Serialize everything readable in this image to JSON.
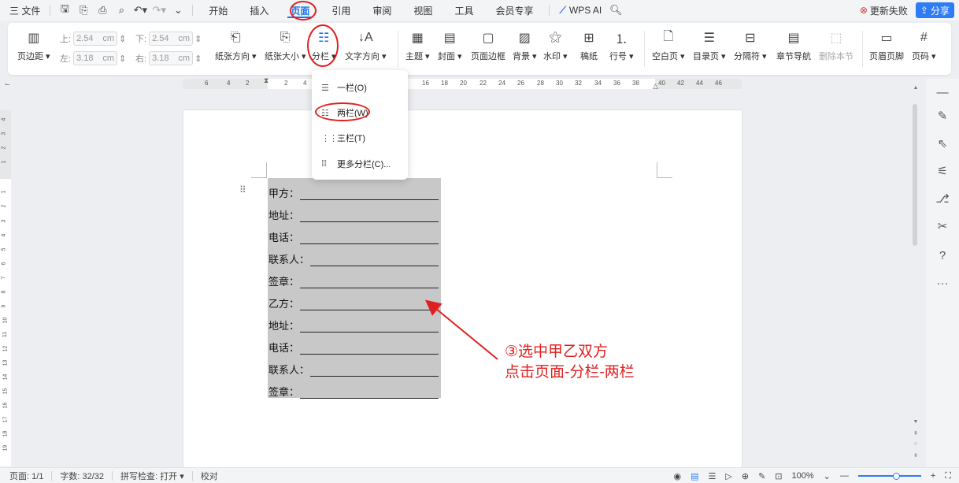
{
  "menubar": {
    "app_menu": "三 文件",
    "quick_icons": [
      "save-icon",
      "export-icon",
      "print-icon",
      "print-preview-icon",
      "undo-icon",
      "redo-icon",
      "more-chevron-icon"
    ],
    "tabs": [
      "开始",
      "插入",
      "页面",
      "引用",
      "审阅",
      "视图",
      "工具",
      "会员专享"
    ],
    "active_tab": "页面",
    "wps_ai": "WPS AI",
    "update_failed": "更新失败",
    "share": "分享"
  },
  "ribbon": {
    "margins": {
      "label": "页边距",
      "top_label": "上:",
      "top": "2.54",
      "bottom_label": "下:",
      "bottom": "2.54",
      "left_label": "左:",
      "left": "3.18",
      "right_label": "右:",
      "right": "3.18",
      "unit": "cm"
    },
    "buttons": [
      "纸张方向",
      "纸张大小",
      "分栏",
      "文字方向",
      "主题",
      "封面",
      "页面边框",
      "背景",
      "水印",
      "稿纸",
      "行号",
      "空白页",
      "目录页",
      "分隔符",
      "章节导航",
      "删除本节",
      "页眉页脚",
      "页码"
    ]
  },
  "ruler": {
    "h_ticks": [
      "6",
      "4",
      "2",
      "2",
      "4",
      "16",
      "18",
      "20",
      "22",
      "24",
      "26",
      "28",
      "30",
      "32",
      "34",
      "36",
      "38",
      "40",
      "42",
      "44",
      "46"
    ],
    "v_ticks": [
      "4",
      "3",
      "2",
      "1",
      "1",
      "2",
      "3",
      "4",
      "5",
      "6",
      "7",
      "8",
      "9",
      "10",
      "11",
      "12",
      "13",
      "14",
      "15",
      "16",
      "17",
      "18",
      "19"
    ]
  },
  "dropdown": {
    "items": [
      "一栏(O)",
      "两栏(W)",
      "三栏(T)",
      "更多分栏(C)..."
    ]
  },
  "document": {
    "lines": [
      "甲方：",
      "地址：",
      "电话：",
      "联系人：",
      "签章：",
      "乙方：",
      "地址：",
      "电话：",
      "联系人：",
      "签章："
    ]
  },
  "annotation": {
    "line1": "③选中甲乙双方",
    "line2": "点击页面-分栏-两栏",
    "color": "#e02020"
  },
  "statusbar": {
    "page": "页面: 1/1",
    "words": "字数: 32/32",
    "spellcheck": "拼写检查: 打开",
    "proofread": "校对",
    "zoom": "100%"
  }
}
